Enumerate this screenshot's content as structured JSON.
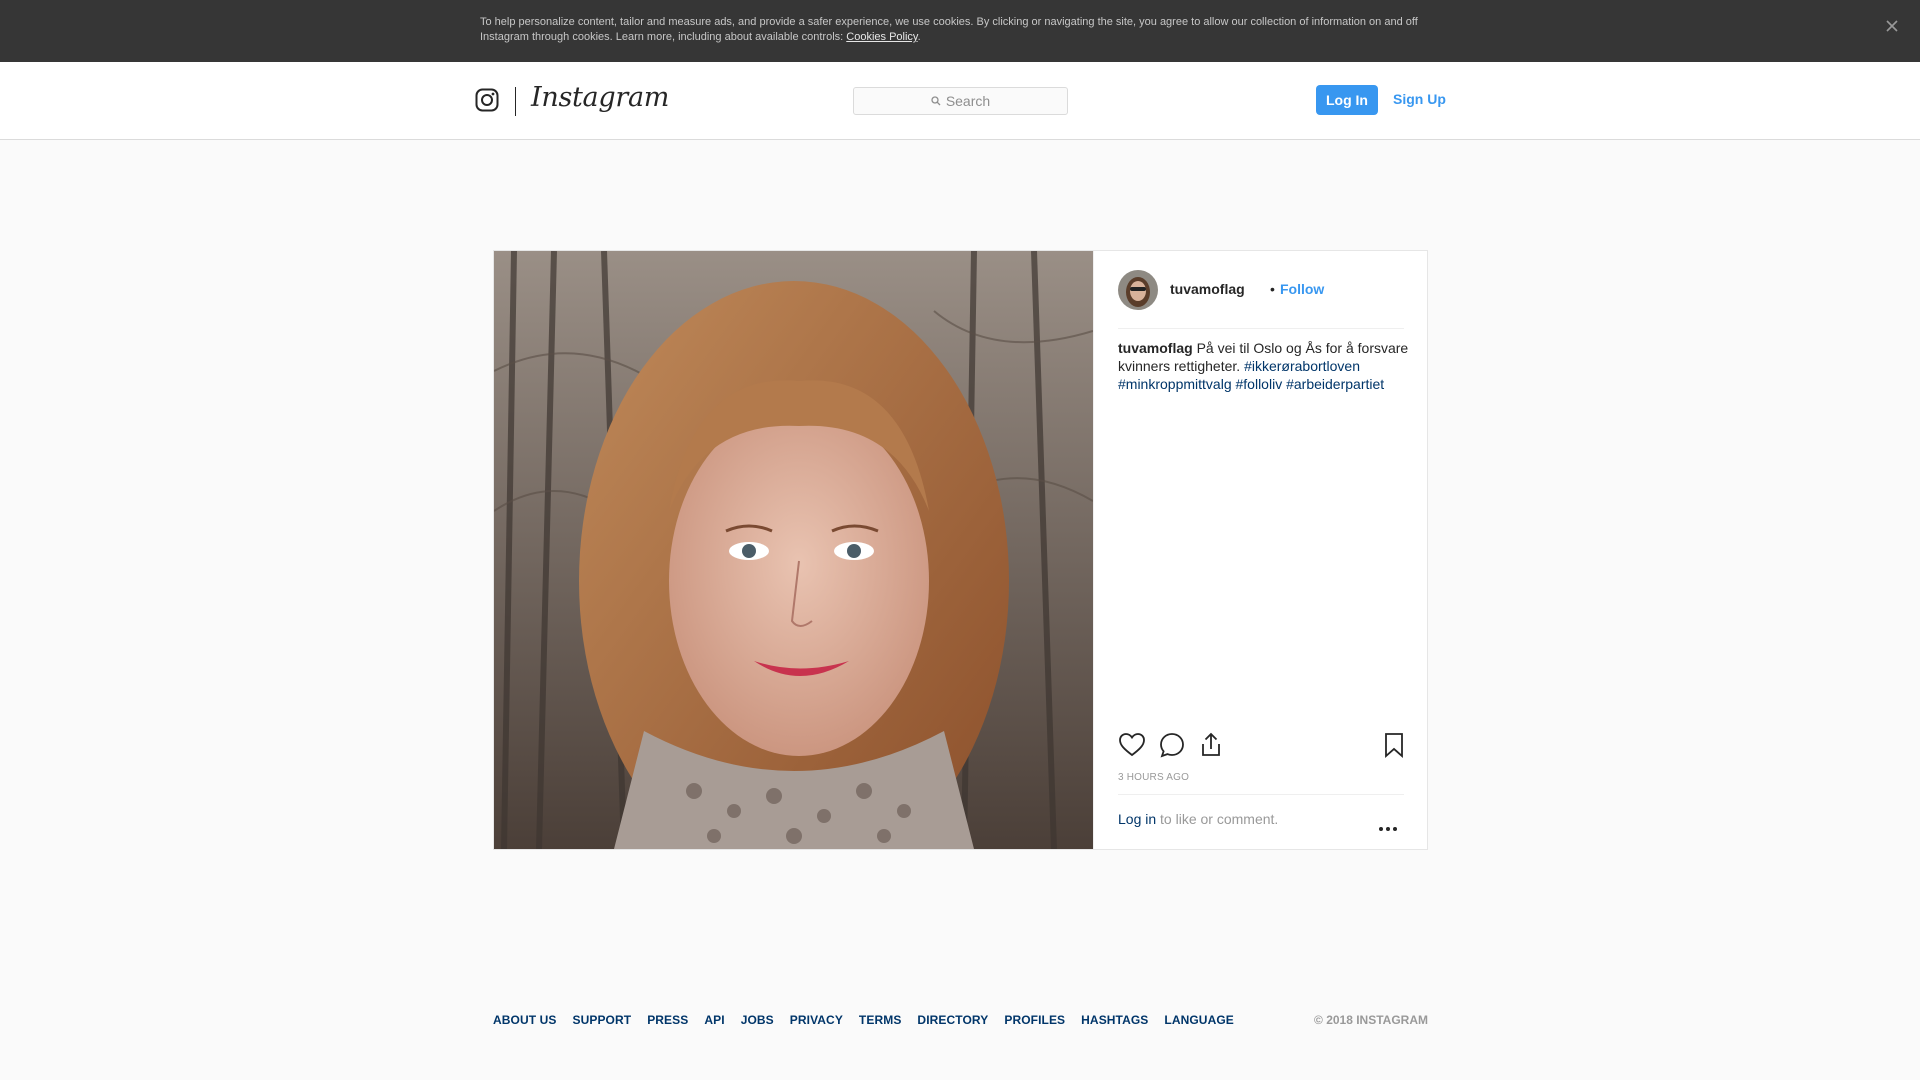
{
  "cookie_banner": {
    "text": "To help personalize content, tailor and measure ads, and provide a safer experience, we use cookies. By clicking or navigating the site, you agree to allow our collection of information on and off Instagram through cookies. Learn more, including about available controls: ",
    "link_label": "Cookies Policy",
    "suffix": "."
  },
  "header": {
    "brand": "Instagram",
    "search_placeholder": "Search",
    "login_label": "Log In",
    "signup_label": "Sign Up"
  },
  "post": {
    "username": "tuvamoflag",
    "separator": "•",
    "follow_label": "Follow",
    "caption_text": " På vei til Oslo og Ås for å forsvare kvinners rettigheter. ",
    "hashtags": [
      "#ikkerørabortloven",
      "#minkroppmittvalg",
      "#folloliv",
      "#arbeiderpartiet"
    ],
    "timestamp": "3 HOURS AGO",
    "login_link": "Log in",
    "login_suffix": " to like or comment."
  },
  "footer": {
    "links": [
      "ABOUT US",
      "SUPPORT",
      "PRESS",
      "API",
      "JOBS",
      "PRIVACY",
      "TERMS",
      "DIRECTORY",
      "PROFILES",
      "HASHTAGS",
      "LANGUAGE"
    ],
    "copyright": "© 2018 INSTAGRAM"
  },
  "colors": {
    "accent": "#3897f0",
    "link": "#003569",
    "banner_bg": "#363636"
  }
}
